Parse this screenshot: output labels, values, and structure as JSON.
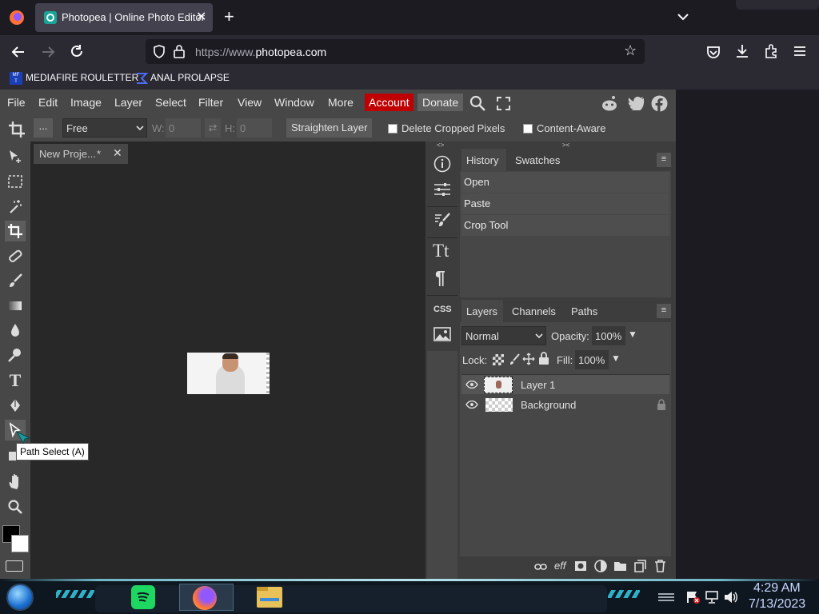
{
  "browser": {
    "tab_title": "Photopea | Online Photo Editor",
    "url_prefix": "https://www.",
    "url_domain": "photopea.com",
    "bookmarks": [
      {
        "label": "MEDIAFIRE ROULETTER"
      },
      {
        "label": "ANAL PROLAPSE"
      }
    ]
  },
  "menu": {
    "items": [
      "File",
      "Edit",
      "Image",
      "Layer",
      "Select",
      "Filter",
      "View",
      "Window",
      "More"
    ],
    "account": "Account",
    "donate": "Donate"
  },
  "tool_options": {
    "more": "...",
    "ratio": "Free",
    "w_label": "W:",
    "w_value": "0",
    "h_label": "H:",
    "h_value": "0",
    "straighten": "Straighten Layer",
    "delete_cropped": "Delete Cropped Pixels",
    "content_aware": "Content-Aware"
  },
  "document": {
    "tab_label": "New Proje...",
    "modified_mark": "*"
  },
  "tooltip": "Path Select (A)",
  "history": {
    "tabs": [
      "History",
      "Swatches"
    ],
    "items": [
      "Open",
      "Paste",
      "Crop Tool"
    ]
  },
  "layers": {
    "tabs": [
      "Layers",
      "Channels",
      "Paths"
    ],
    "blend_mode": "Normal",
    "opacity_label": "Opacity:",
    "opacity_value": "100%",
    "lock_label": "Lock:",
    "fill_label": "Fill:",
    "fill_value": "100%",
    "items": [
      {
        "name": "Layer 1"
      },
      {
        "name": "Background"
      }
    ]
  },
  "taskbar": {
    "time": "4:29 AM",
    "date": "7/13/2023"
  },
  "colors": {
    "account_bg": "#c00000",
    "selected_layer": "#555555",
    "clock_color": "#c8d8ff"
  }
}
